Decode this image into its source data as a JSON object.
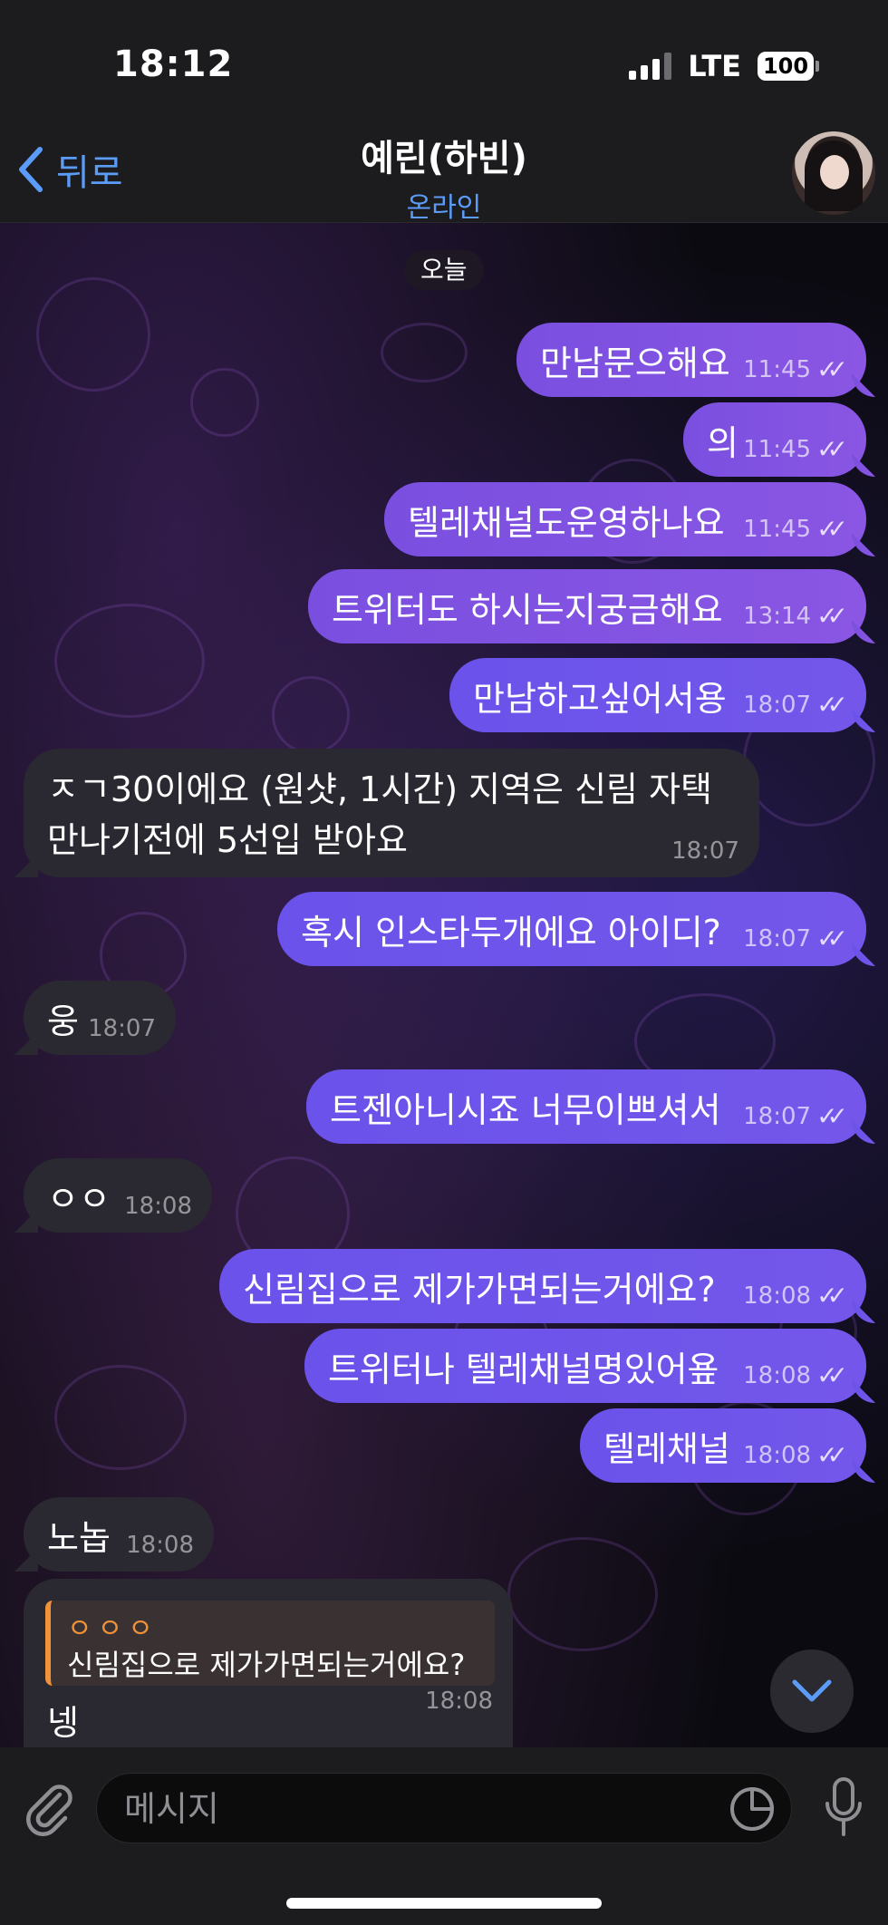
{
  "status": {
    "time": "18:12",
    "network": "LTE",
    "battery": "100"
  },
  "header": {
    "back_label": "뒤로",
    "title": "예린(하빈)",
    "subtitle": "온라인"
  },
  "chat": {
    "date_chip": "오늘",
    "messages": [
      {
        "dir": "out",
        "text": "만남문으해요",
        "time": "11:45"
      },
      {
        "dir": "out",
        "text": "의",
        "time": "11:45"
      },
      {
        "dir": "out",
        "text": "텔레채널도운영하나요",
        "time": "11:45"
      },
      {
        "dir": "out",
        "text": "트위터도 하시는지궁금해요",
        "time": "13:14"
      },
      {
        "dir": "out",
        "text": "만남하고싶어서용",
        "time": "18:07"
      },
      {
        "dir": "in",
        "line1": "ㅈㄱ30이에요 (원샷, 1시간) 지역은 신림 자택",
        "line2": "만나기전에 5선입 받아요",
        "time": "18:07"
      },
      {
        "dir": "out",
        "text": "혹시 인스타두개에요 아이디?",
        "time": "18:07"
      },
      {
        "dir": "in",
        "text": "웅",
        "time": "18:07"
      },
      {
        "dir": "out",
        "text": "트젠아니시죠 너무이쁘셔서",
        "time": "18:07"
      },
      {
        "dir": "in",
        "text": "ㅇㅇ",
        "time": "18:08"
      },
      {
        "dir": "out",
        "text": "신림집으로 제가가면되는거에요?",
        "time": "18:08"
      },
      {
        "dir": "out",
        "text": "트위터나 텔레채널명있어욮",
        "time": "18:08"
      },
      {
        "dir": "out",
        "text": "텔레채널",
        "time": "18:08"
      },
      {
        "dir": "in",
        "text": "노놉",
        "time": "18:08"
      },
      {
        "dir": "in",
        "reply_name": "ㅇㅇㅇ",
        "reply_text": "신림집으로 제가가면되는거에요?",
        "text": "넹",
        "time": "18:08"
      }
    ]
  },
  "input": {
    "placeholder": "메시지"
  },
  "icons": {
    "back": "chevron-left-icon",
    "attach": "paperclip-icon",
    "sticker": "sticker-icon",
    "mic": "microphone-icon",
    "scroll": "chevron-down-icon",
    "read": "double-check-icon"
  },
  "colors": {
    "accent": "#5a9cf8",
    "outgoing": "#7a4fe0",
    "incoming": "#2a2830",
    "reply_accent": "#f0923a"
  }
}
